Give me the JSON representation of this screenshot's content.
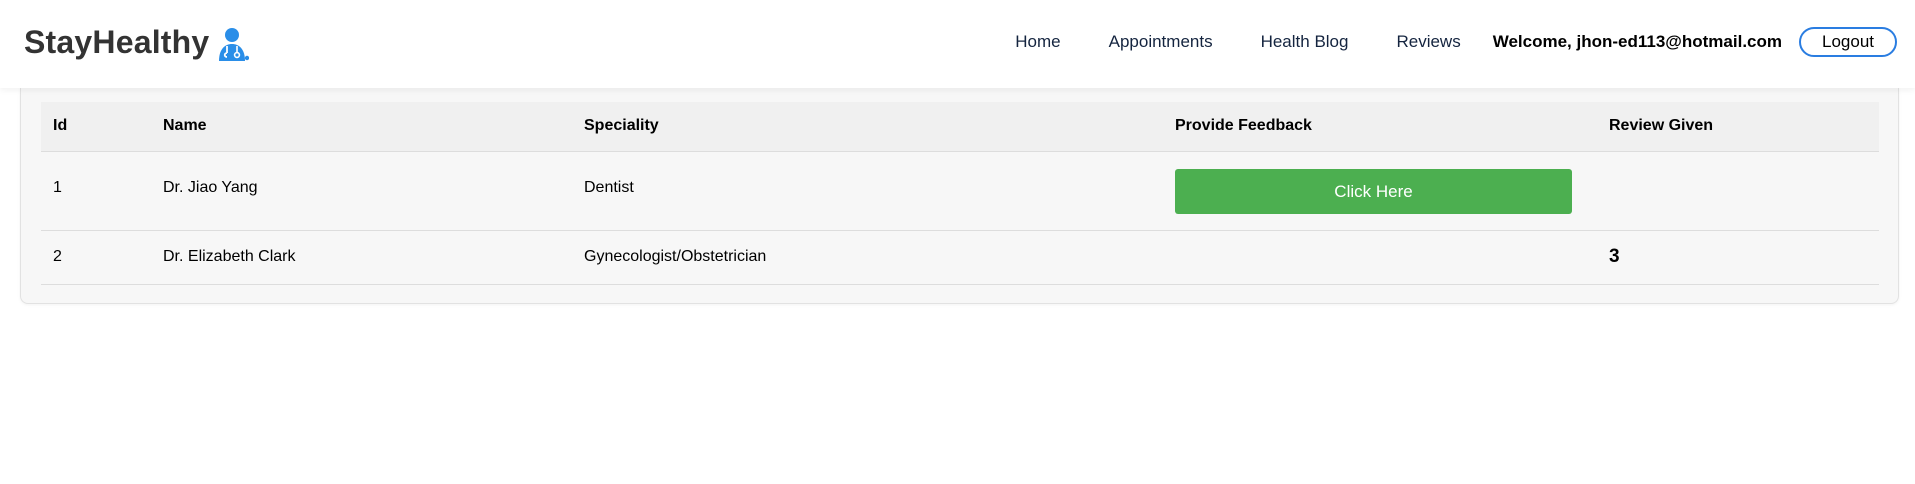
{
  "brand": {
    "name": "StayHealthy",
    "icon": "doctor-icon",
    "icon_color": "#2a8ee8"
  },
  "nav": {
    "home": "Home",
    "appointments": "Appointments",
    "health_blog": "Health Blog",
    "reviews": "Reviews",
    "welcome": "Welcome, jhon-ed113@hotmail.com",
    "logout": "Logout"
  },
  "table": {
    "headers": [
      "Id",
      "Name",
      "Speciality",
      "Provide Feedback",
      "Review Given"
    ],
    "rows": [
      {
        "id": "1",
        "name": "Dr. Jiao Yang",
        "speciality": "Dentist",
        "feedback_button": "Click Here",
        "review": ""
      },
      {
        "id": "2",
        "name": "Dr. Elizabeth Clark",
        "speciality": "Gynecologist/Obstetrician",
        "feedback_button": "",
        "review": "3"
      }
    ]
  },
  "colors": {
    "accent": "#2a7de1",
    "feedback_button": "#4caf50",
    "brand_text": "#333333"
  }
}
